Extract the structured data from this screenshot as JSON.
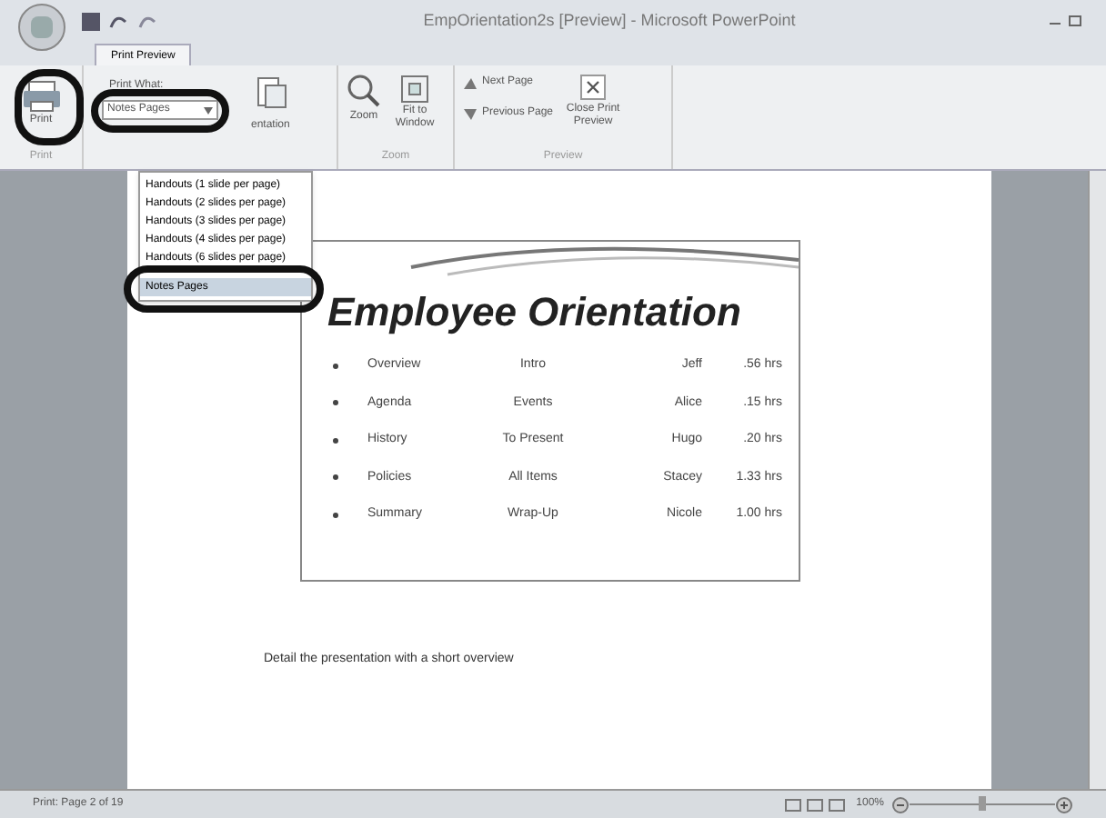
{
  "window": {
    "title": "EmpOrientation2s [Preview] - Microsoft PowerPoint"
  },
  "tabs": [
    {
      "label": "Print Preview",
      "selected": true
    }
  ],
  "ribbon": {
    "print_button": "Print",
    "print_what_label": "Print What:",
    "print_what_value": "Notes Pages",
    "orientation_button": "entation",
    "zoom_button": "Zoom",
    "fit_button": "Fit to Window",
    "next_page": "Next Page",
    "previous_page": "Previous Page",
    "close_button": "Close Print Preview",
    "group_labels": [
      "Print",
      "Zoom",
      "Preview"
    ]
  },
  "print_what_menu": [
    {
      "label": "Handouts (1 slide per page)",
      "selected": false
    },
    {
      "label": "Handouts (2 slides per page)",
      "selected": false
    },
    {
      "label": "Handouts (3 slides per page)",
      "selected": false
    },
    {
      "label": "Handouts (4 slides per page)",
      "selected": false
    },
    {
      "label": "Handouts (6 slides per page)",
      "selected": false
    },
    {
      "label": "Notes Pages",
      "selected": true
    }
  ],
  "slide": {
    "title": "Employee Orientation",
    "rows": [
      [
        "Overview",
        "Intro",
        "Jeff",
        ".56 hrs"
      ],
      [
        "Agenda",
        "Events",
        "Alice",
        ".15 hrs"
      ],
      [
        "History",
        "To Present",
        "Hugo",
        ".20 hrs"
      ],
      [
        "Policies",
        "All Items",
        "Stacey",
        "1.33 hrs"
      ],
      [
        "Summary",
        "Wrap-Up",
        "Nicole",
        "1.00 hrs"
      ]
    ]
  },
  "notes": "Detail the presentation with a short overview",
  "status_bar": {
    "page": "Print: Page 2 of 19",
    "zoom": "100%",
    "zoom_slider": {
      "level": 0.5
    }
  }
}
